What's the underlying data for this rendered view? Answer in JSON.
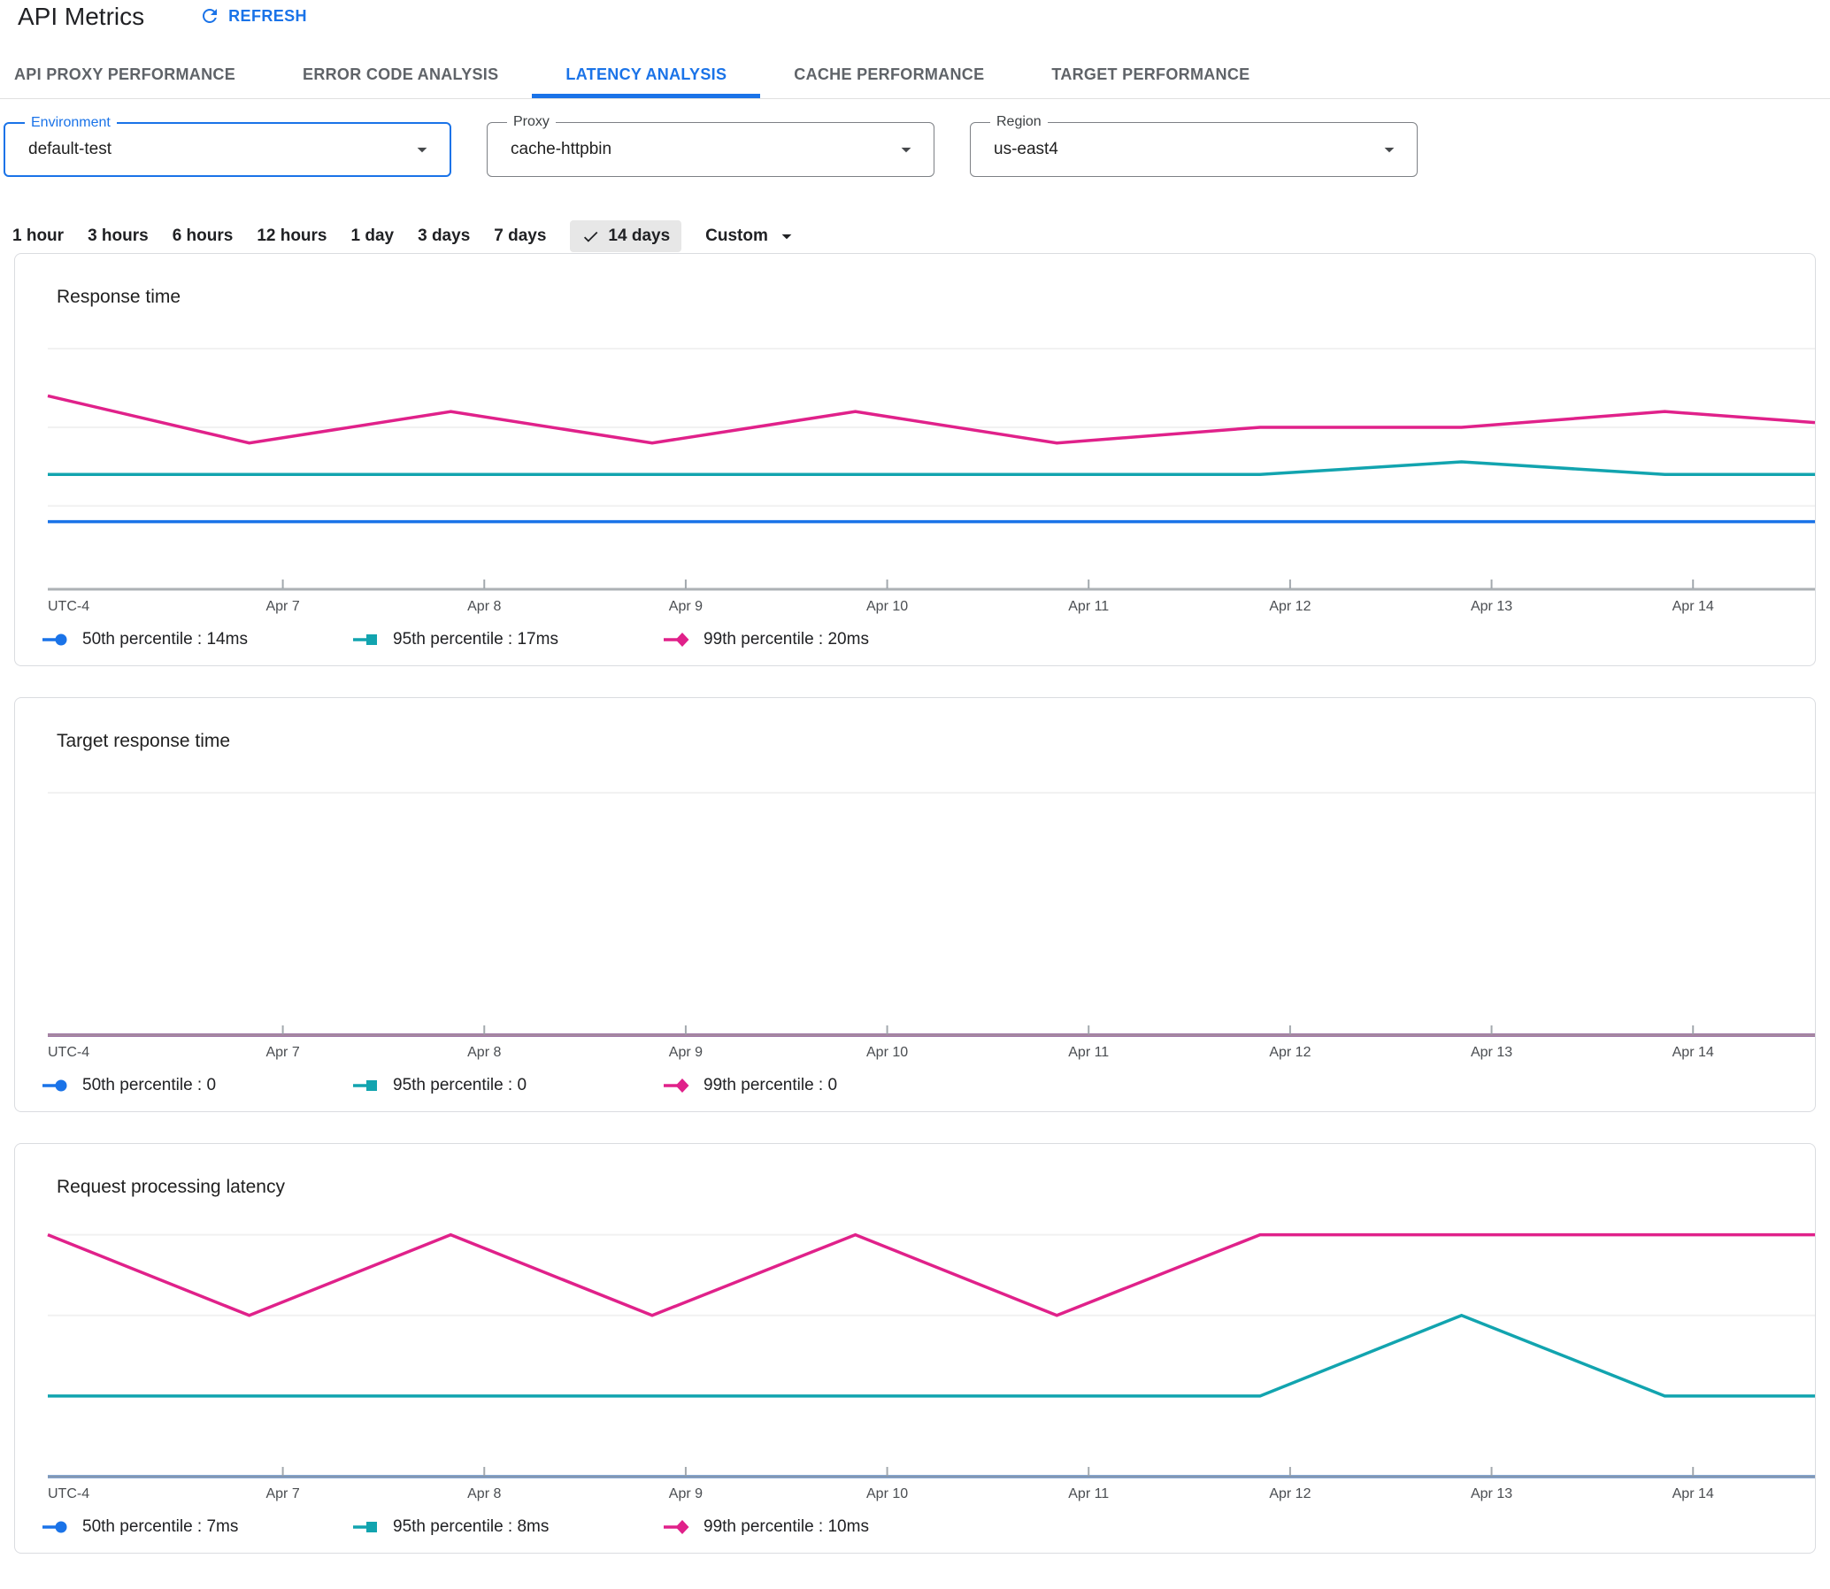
{
  "header": {
    "title": "API Metrics",
    "refresh_label": "REFRESH"
  },
  "tabs": [
    {
      "label": "API PROXY PERFORMANCE",
      "active": false
    },
    {
      "label": "ERROR CODE ANALYSIS",
      "active": false
    },
    {
      "label": "LATENCY ANALYSIS",
      "active": true
    },
    {
      "label": "CACHE PERFORMANCE",
      "active": false
    },
    {
      "label": "TARGET PERFORMANCE",
      "active": false
    }
  ],
  "filters": [
    {
      "label": "Environment",
      "value": "default-test",
      "focused": true
    },
    {
      "label": "Proxy",
      "value": "cache-httpbin",
      "focused": false
    },
    {
      "label": "Region",
      "value": "us-east4",
      "focused": false
    }
  ],
  "time_ranges": {
    "options": [
      "1 hour",
      "3 hours",
      "6 hours",
      "12 hours",
      "1 day",
      "3 days",
      "7 days",
      "14 days"
    ],
    "selected": "14 days",
    "custom_label": "Custom"
  },
  "x_axis": {
    "timezone_label": "UTC-4",
    "tick_labels": [
      "Apr 7",
      "Apr 8",
      "Apr 9",
      "Apr 10",
      "Apr 11",
      "Apr 12",
      "Apr 13",
      "Apr 14"
    ],
    "tick_fractions": [
      0.133,
      0.247,
      0.361,
      0.475,
      0.589,
      0.703,
      0.817,
      0.931
    ]
  },
  "colors": {
    "accent_blue": "#1a73e8",
    "p50_blue": "#1a73e8",
    "p95_teal": "#12a4af",
    "p99_pink": "#e0218a",
    "gridline": "#f1f1f1",
    "axis_line": "#9aa0a6",
    "text_primary": "#202124",
    "text_secondary": "#5f6368"
  },
  "chart_data": [
    {
      "type": "line",
      "title": "Response time",
      "unit": "ms",
      "grid": true,
      "legend_position": "bottom",
      "x_fractions": [
        0,
        0.114,
        0.228,
        0.342,
        0.457,
        0.571,
        0.686,
        0.8,
        0.915,
        1
      ],
      "ylim": [
        9.7,
        27.2
      ],
      "gridline_values": [
        15,
        20,
        25
      ],
      "series": [
        {
          "name": "50th percentile",
          "legend_label": "50th percentile : 14ms",
          "marker": "circle",
          "color": "#1a73e8",
          "values": [
            14,
            14,
            14,
            14,
            14,
            14,
            14,
            14,
            14,
            14
          ]
        },
        {
          "name": "95th percentile",
          "legend_label": "95th percentile : 17ms",
          "marker": "square",
          "color": "#12a4af",
          "values": [
            17,
            17,
            17,
            17,
            17,
            17,
            17,
            17.8,
            17,
            17
          ]
        },
        {
          "name": "99th percentile",
          "legend_label": "99th percentile : 20ms",
          "marker": "diamond",
          "color": "#e0218a",
          "values": [
            22,
            19,
            21,
            19,
            21,
            19,
            20,
            20,
            21,
            20.3
          ]
        }
      ]
    },
    {
      "type": "line",
      "title": "Target response time",
      "unit": "ms",
      "grid": true,
      "legend_position": "bottom",
      "x_fractions": [
        0,
        0.114,
        0.228,
        0.342,
        0.457,
        0.571,
        0.686,
        0.8,
        0.915,
        1
      ],
      "ylim": [
        0,
        8
      ],
      "gridline_values": [
        7
      ],
      "series": [
        {
          "name": "50th percentile",
          "legend_label": "50th percentile : 0",
          "marker": "circle",
          "color": "#1a73e8",
          "values": [
            0,
            0,
            0,
            0,
            0,
            0,
            0,
            0,
            0,
            0
          ]
        },
        {
          "name": "95th percentile",
          "legend_label": "95th percentile : 0",
          "marker": "square",
          "color": "#12a4af",
          "values": [
            0,
            0,
            0,
            0,
            0,
            0,
            0,
            0,
            0,
            0
          ]
        },
        {
          "name": "99th percentile",
          "legend_label": "99th percentile : 0",
          "marker": "diamond",
          "color": "#e0218a",
          "values": [
            0,
            0,
            0,
            0,
            0,
            0,
            0,
            0,
            0,
            0
          ]
        }
      ]
    },
    {
      "type": "line",
      "title": "Request processing latency",
      "unit": "ms",
      "grid": true,
      "legend_position": "bottom",
      "x_fractions": [
        0,
        0.114,
        0.228,
        0.342,
        0.457,
        0.571,
        0.686,
        0.8,
        0.915,
        1
      ],
      "ylim": [
        7.0,
        10.38
      ],
      "gridline_values": [
        9,
        10
      ],
      "series": [
        {
          "name": "50th percentile",
          "legend_label": "50th percentile : 7ms",
          "marker": "circle",
          "color": "#1a73e8",
          "values": [
            7,
            7,
            7,
            7,
            7,
            7,
            7,
            7,
            7,
            7
          ]
        },
        {
          "name": "95th percentile",
          "legend_label": "95th percentile : 8ms",
          "marker": "square",
          "color": "#12a4af",
          "values": [
            8,
            8,
            8,
            8,
            8,
            8,
            8,
            9,
            8,
            8
          ]
        },
        {
          "name": "99th percentile",
          "legend_label": "99th percentile : 10ms",
          "marker": "diamond",
          "color": "#e0218a",
          "values": [
            10,
            9,
            10,
            9,
            10,
            9,
            10,
            10,
            10,
            10
          ]
        }
      ]
    }
  ]
}
